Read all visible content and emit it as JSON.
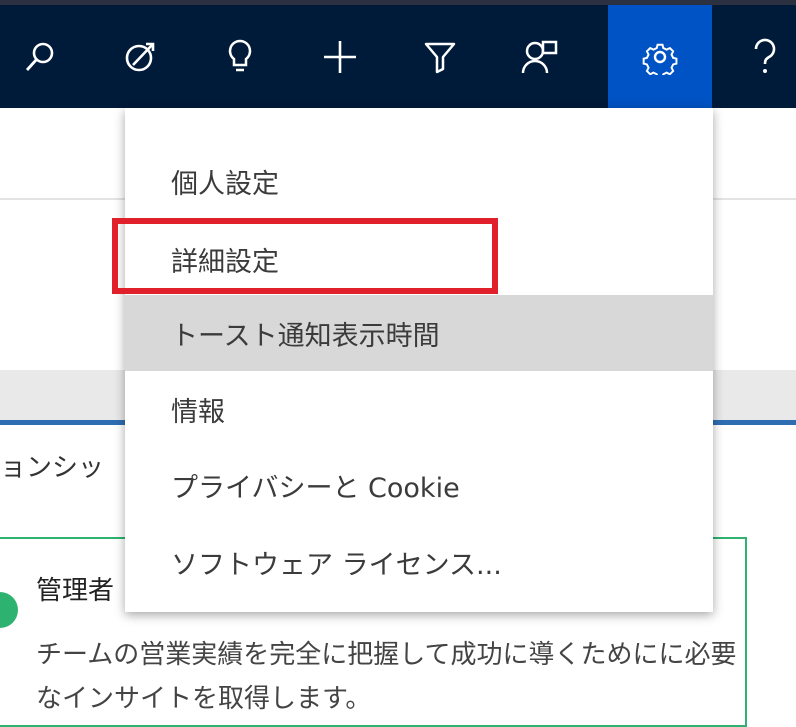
{
  "topbar": {
    "icons": [
      {
        "name": "search-icon"
      },
      {
        "name": "task-icon"
      },
      {
        "name": "lightbulb-icon"
      },
      {
        "name": "new-icon"
      },
      {
        "name": "filter-icon"
      },
      {
        "name": "assistant-icon"
      },
      {
        "name": "settings-icon",
        "active": true
      },
      {
        "name": "help-icon"
      }
    ],
    "colors": {
      "background": "#001a3a",
      "active": "#0053c4"
    }
  },
  "menu": {
    "items": [
      {
        "label": "個人設定"
      },
      {
        "label": "詳細設定",
        "highlighted_by_red_box": true
      },
      {
        "label": "トースト通知表示時間",
        "hovered": true
      },
      {
        "label": "情報"
      },
      {
        "label": "プライバシーと Cookie"
      },
      {
        "label": "ソフトウェア ライセンス..."
      }
    ]
  },
  "background": {
    "tab_text": "ョンシッ",
    "card": {
      "title": "管理者",
      "body": "チームの営業実績を完全に把握して成功に導くためにに必要なインサイトを取得します。"
    }
  },
  "colors": {
    "highlight_box": "#e0202a",
    "card_border": "#2db36f",
    "accent_line": "#2f6db2"
  }
}
